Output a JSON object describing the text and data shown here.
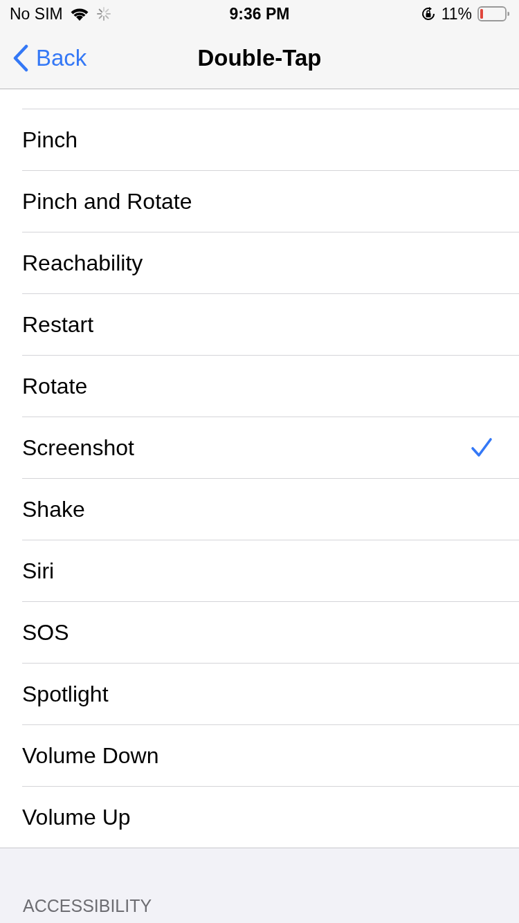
{
  "status_bar": {
    "carrier": "No SIM",
    "time": "9:36 PM",
    "battery": "11%"
  },
  "nav": {
    "back": "Back",
    "title": "Double-Tap"
  },
  "options": [
    {
      "label": "Pinch",
      "selected": false
    },
    {
      "label": "Pinch and Rotate",
      "selected": false
    },
    {
      "label": "Reachability",
      "selected": false
    },
    {
      "label": "Restart",
      "selected": false
    },
    {
      "label": "Rotate",
      "selected": false
    },
    {
      "label": "Screenshot",
      "selected": true
    },
    {
      "label": "Shake",
      "selected": false
    },
    {
      "label": "Siri",
      "selected": false
    },
    {
      "label": "SOS",
      "selected": false
    },
    {
      "label": "Spotlight",
      "selected": false
    },
    {
      "label": "Volume Down",
      "selected": false
    },
    {
      "label": "Volume Up",
      "selected": false
    }
  ],
  "section_header": "ACCESSIBILITY"
}
